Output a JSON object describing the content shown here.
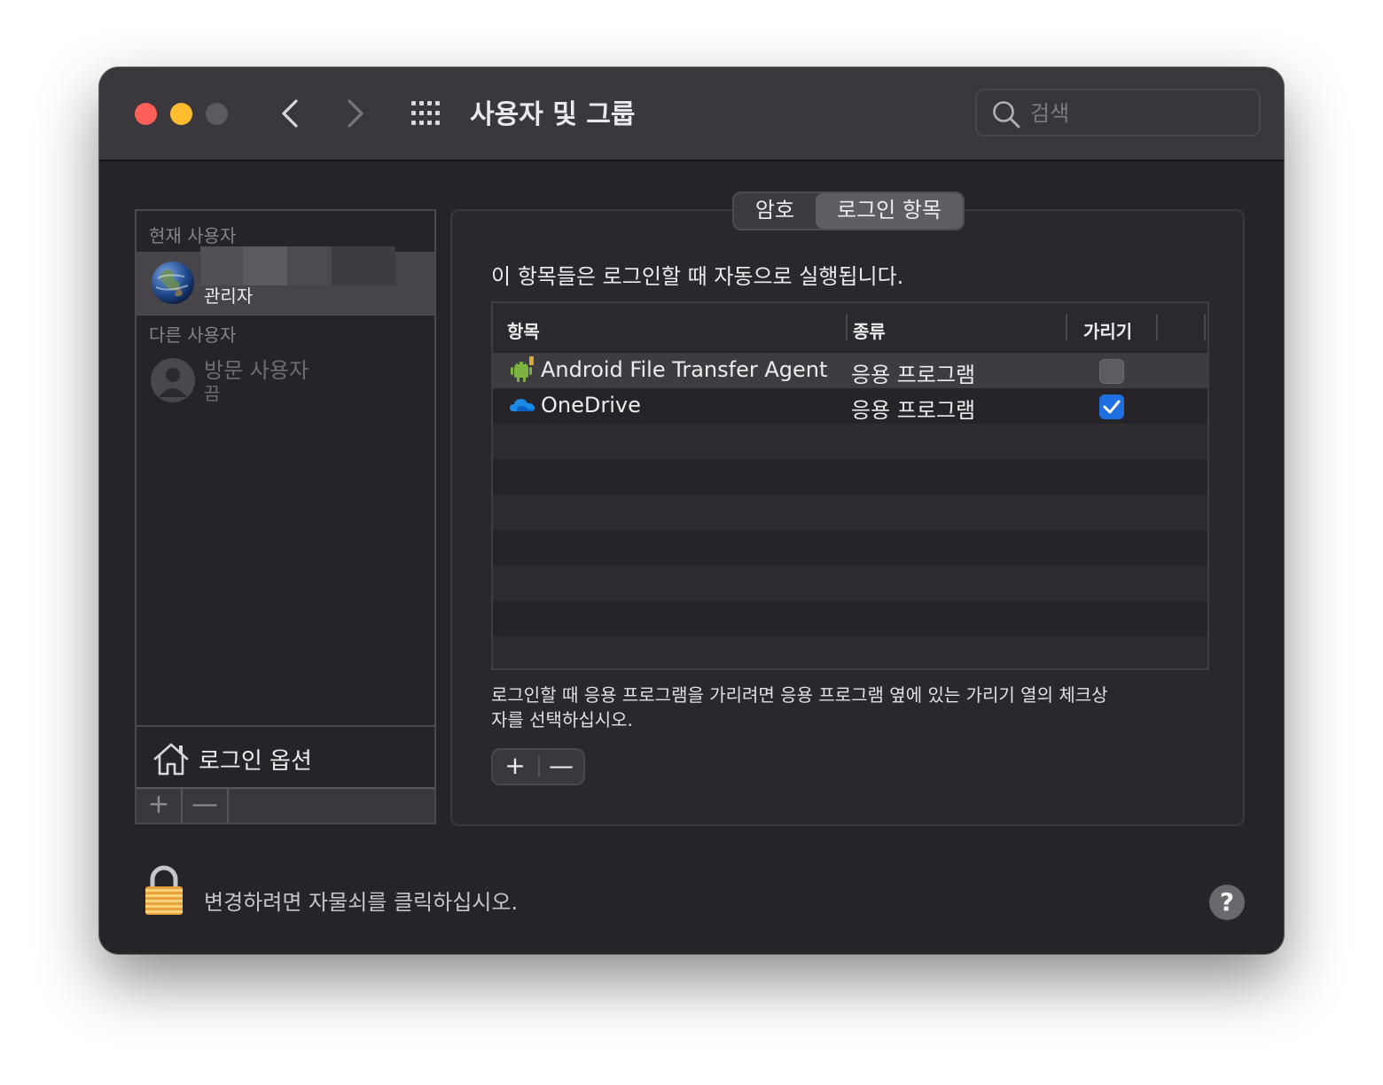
{
  "window": {
    "title": "사용자 및 그룹",
    "search_placeholder": "검색"
  },
  "users_pane": {
    "current_user_header": "현재 사용자",
    "current_user": {
      "role": "관리자"
    },
    "other_users_header": "다른 사용자",
    "guest": {
      "name": "방문 사용자",
      "status": "끔"
    },
    "login_options_label": "로그인 옵션",
    "add_label": "+",
    "remove_label": "—"
  },
  "tabs": [
    {
      "label": "암호",
      "selected": false
    },
    {
      "label": "로그인 항목",
      "selected": true
    }
  ],
  "login_items": {
    "description": "이 항목들은 로그인할 때 자동으로 실행됩니다.",
    "columns": [
      "항목",
      "종류",
      "가리기"
    ],
    "rows": [
      {
        "name": "Android File Transfer Agent",
        "kind": "응용 프로그램",
        "hide": false,
        "icon": "android-icon"
      },
      {
        "name": "OneDrive",
        "kind": "응용 프로그램",
        "hide": true,
        "icon": "onedrive-cloud-icon"
      }
    ],
    "hint": "로그인할 때 응용 프로그램을 가리려면 응용 프로그램 옆에 있는 가리기 열의 체크상자를 선택하십시오.",
    "add_label": "+",
    "remove_label": "—"
  },
  "footer": {
    "lock_text": "변경하려면 자물쇠를 클릭하십시오.",
    "help_label": "?"
  },
  "colors": {
    "close": "#fe5f57",
    "minimize": "#febc2e",
    "checkbox_on": "#1f6fe0"
  }
}
